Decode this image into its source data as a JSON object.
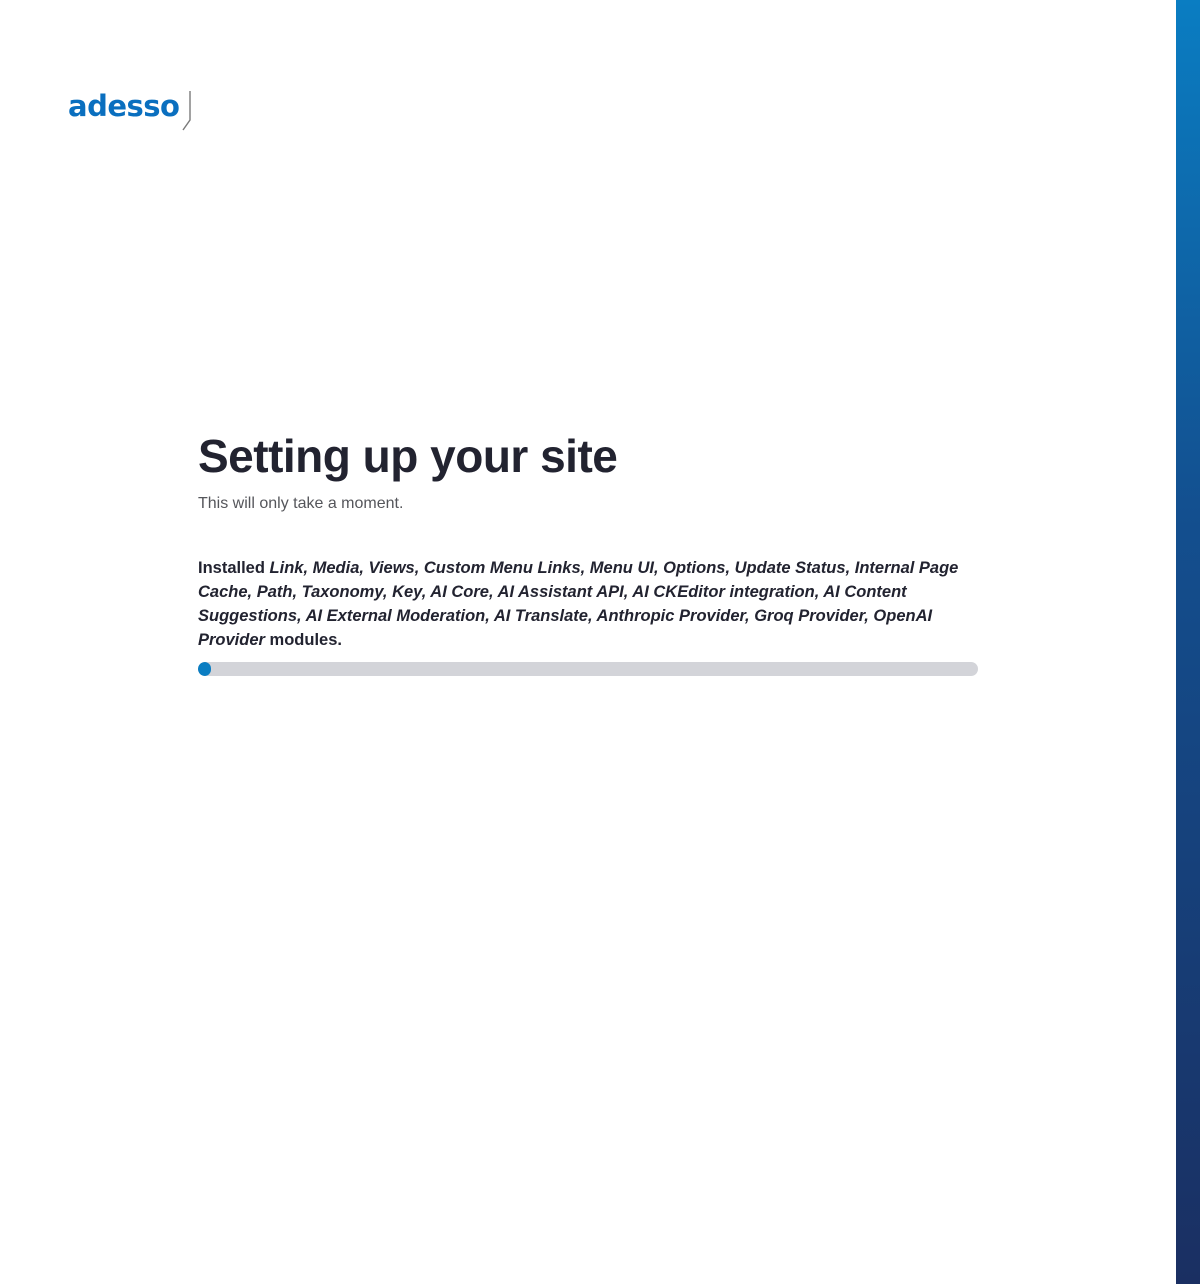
{
  "brand": {
    "name": "adesso",
    "color": "#0a6fbf",
    "stripe_top_color": "#0a7dc2",
    "stripe_bottom_color": "#1a2f62"
  },
  "main": {
    "title": "Setting up your site",
    "subtitle": "This will only take a moment.",
    "status_prefix": "Installed",
    "status_modules": "Link, Media, Views, Custom Menu Links, Menu UI, Options, Update Status, Internal Page Cache, Path, Taxonomy, Key, AI Core, AI Assistant API, AI CKEditor integration, AI Content Suggestions, AI External Moderation, AI Translate, Anthropic Provider, Groq Provider, OpenAI Provider",
    "status_suffix": "modules.",
    "progress_fraction": 0.017,
    "progress_color": "#0a7dc2"
  }
}
